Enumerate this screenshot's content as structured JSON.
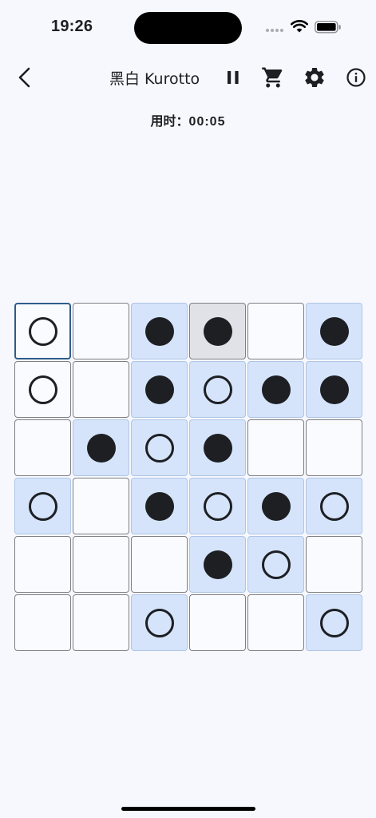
{
  "status_bar": {
    "time": "19:26"
  },
  "app_bar": {
    "title": "黑白 Kurotto"
  },
  "timer": {
    "label": "用时：",
    "value": "00:05"
  },
  "board": {
    "rows": [
      [
        {
          "stone": "white",
          "hl": false,
          "selected": true
        },
        {
          "stone": "",
          "hl": false
        },
        {
          "stone": "black",
          "hl": true
        },
        {
          "stone": "black",
          "hl": false,
          "dark": true
        },
        {
          "stone": "",
          "hl": false
        },
        {
          "stone": "black",
          "hl": true
        }
      ],
      [
        {
          "stone": "white",
          "hl": false
        },
        {
          "stone": "",
          "hl": false
        },
        {
          "stone": "black",
          "hl": true
        },
        {
          "stone": "white",
          "hl": true
        },
        {
          "stone": "black",
          "hl": true
        },
        {
          "stone": "black",
          "hl": true
        }
      ],
      [
        {
          "stone": "",
          "hl": false
        },
        {
          "stone": "black",
          "hl": true
        },
        {
          "stone": "white",
          "hl": true
        },
        {
          "stone": "black",
          "hl": true
        },
        {
          "stone": "",
          "hl": false
        },
        {
          "stone": "",
          "hl": false
        }
      ],
      [
        {
          "stone": "white",
          "hl": true
        },
        {
          "stone": "",
          "hl": false
        },
        {
          "stone": "black",
          "hl": true
        },
        {
          "stone": "white",
          "hl": true
        },
        {
          "stone": "black",
          "hl": true
        },
        {
          "stone": "white",
          "hl": true
        }
      ],
      [
        {
          "stone": "",
          "hl": false
        },
        {
          "stone": "",
          "hl": false
        },
        {
          "stone": "",
          "hl": false
        },
        {
          "stone": "black",
          "hl": true
        },
        {
          "stone": "white",
          "hl": true
        },
        {
          "stone": "",
          "hl": false
        }
      ],
      [
        {
          "stone": "",
          "hl": false
        },
        {
          "stone": "",
          "hl": false
        },
        {
          "stone": "white",
          "hl": true
        },
        {
          "stone": "",
          "hl": false
        },
        {
          "stone": "",
          "hl": false
        },
        {
          "stone": "white",
          "hl": true
        }
      ]
    ]
  },
  "colors": {
    "background": "#f7f8fd",
    "highlight": "#d5e4fb",
    "stone": "#1d1f23",
    "selected_border": "#2f5c8a"
  },
  "icons": [
    "back-icon",
    "pause-icon",
    "cart-icon",
    "settings-icon",
    "info-icon",
    "wifi-icon",
    "battery-icon"
  ]
}
